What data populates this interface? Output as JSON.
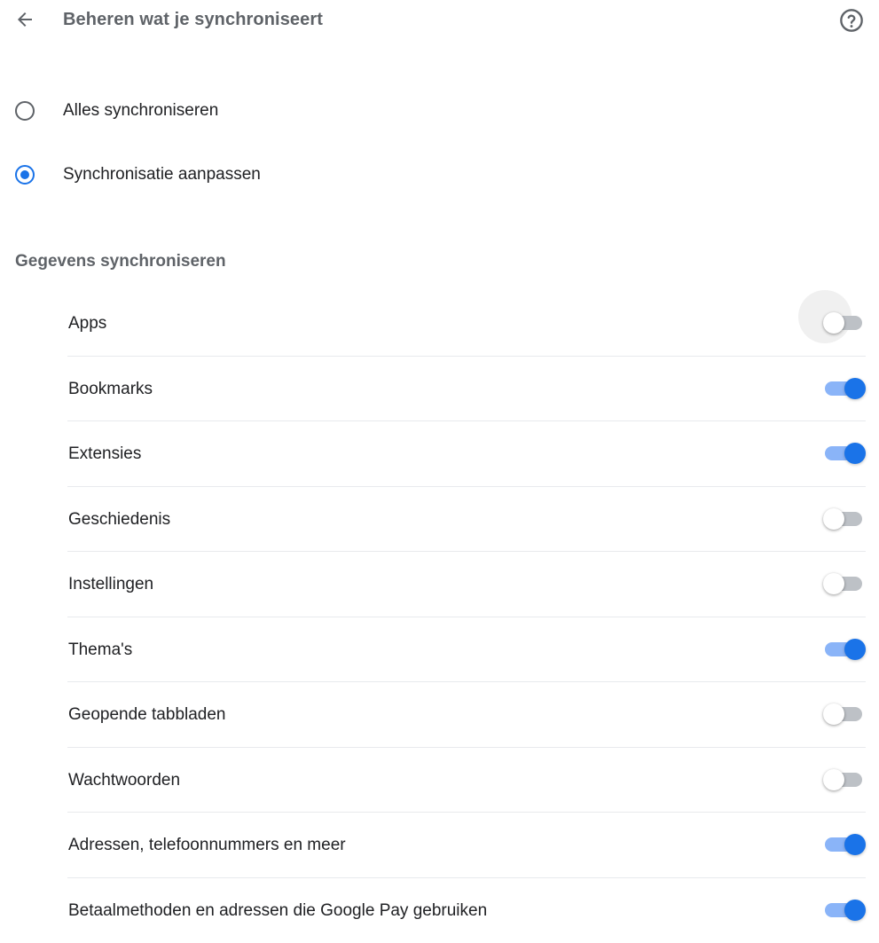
{
  "header": {
    "title": "Beheren wat je synchroniseert",
    "back_icon": "arrow-back-icon",
    "help_icon": "help-circle-icon"
  },
  "sync_mode": {
    "options": [
      {
        "label": "Alles synchroniseren",
        "selected": false
      },
      {
        "label": "Synchronisatie aanpassen",
        "selected": true
      }
    ]
  },
  "data_section": {
    "title": "Gegevens synchroniseren",
    "items": [
      {
        "label": "Apps",
        "enabled": false
      },
      {
        "label": "Bookmarks",
        "enabled": true
      },
      {
        "label": "Extensies",
        "enabled": true
      },
      {
        "label": "Geschiedenis",
        "enabled": false
      },
      {
        "label": "Instellingen",
        "enabled": false
      },
      {
        "label": "Thema's",
        "enabled": true
      },
      {
        "label": "Geopende tabbladen",
        "enabled": false
      },
      {
        "label": "Wachtwoorden",
        "enabled": false
      },
      {
        "label": "Adressen, telefoonnummers en meer",
        "enabled": true
      },
      {
        "label": "Betaalmethoden en adressen die Google Pay gebruiken",
        "enabled": true
      }
    ]
  },
  "colors": {
    "accent": "#1a73e8",
    "accent_track": "#8ab4f8",
    "off_track": "#bdc1c6",
    "secondary_text": "#5f6368",
    "primary_text": "#202124",
    "divider": "#e8eaed"
  }
}
